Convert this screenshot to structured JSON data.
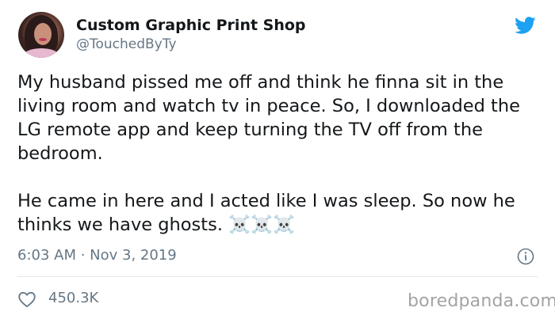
{
  "author": {
    "display_name": "Custom Graphic Print Shop",
    "handle": "@TouchedByTy"
  },
  "tweet": {
    "text": "My husband pissed me off and think he finna sit in the living room and watch tv in peace. So, I downloaded the LG remote app and keep turning the TV off from the bedroom.\n\nHe came in here and I acted like I was sleep. So now he thinks we have ghosts. ☠️☠️☠️",
    "timestamp": "6:03 AM · Nov 3, 2019"
  },
  "engagement": {
    "likes": "450.3K"
  },
  "watermark": "boredpanda.com",
  "icons": {
    "platform": "twitter-bird-icon",
    "info": "info-icon",
    "like": "heart-icon"
  },
  "colors": {
    "brand_blue": "#1da1f2",
    "secondary_text": "#657786",
    "primary_text": "#14171a",
    "divider": "#e1e8ed",
    "watermark": "#a3a3a3"
  }
}
